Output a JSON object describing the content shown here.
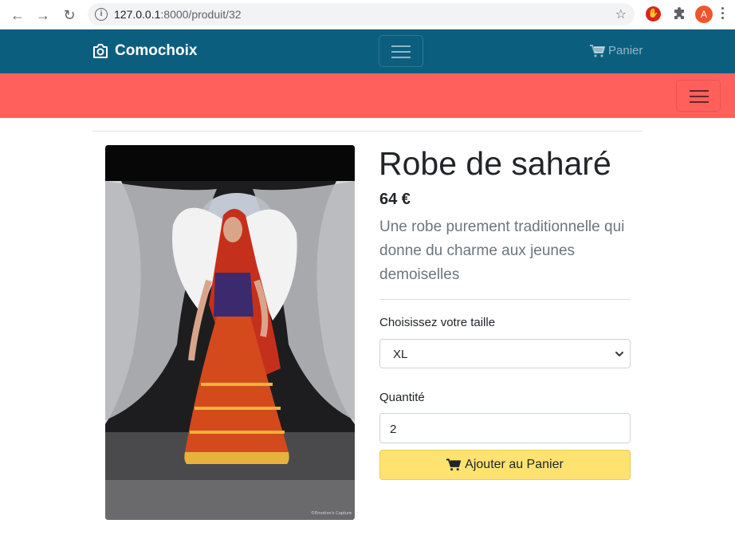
{
  "browser": {
    "url_host": "127.0.0.1",
    "url_path": ":8000/produit/32",
    "avatar_letter": "A"
  },
  "navbar": {
    "brand": "Comochoix",
    "cart_label": "Panier",
    "color": "#0c5e7f"
  },
  "subnav": {
    "color": "#ff605c"
  },
  "product": {
    "title": "Robe de saharé",
    "price": "64 €",
    "description": "Une robe purement traditionnelle qui donne du charme aux jeunes demoiselles",
    "size_label": "Choisissez votre taille",
    "size_value": "XL",
    "qty_label": "Quantité",
    "qty_value": "2",
    "add_button": "Ajouter au Panier",
    "photo_credit": "©Emotion's Capture"
  }
}
